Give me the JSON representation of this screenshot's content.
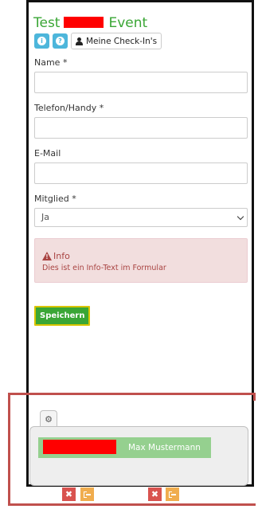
{
  "header": {
    "title_prefix": "Test",
    "title_suffix": "Event",
    "info_icon": "info-circle-icon",
    "help_icon": "question-circle-icon",
    "checkins_label": "Meine Check-In's"
  },
  "form": {
    "name_label": "Name *",
    "name_value": "",
    "phone_label": "Telefon/Handy *",
    "phone_value": "",
    "email_label": "E-Mail",
    "email_value": "",
    "member_label": "Mitglied *",
    "member_selected": "Ja",
    "save_label": "Speichern"
  },
  "alert": {
    "heading": "Info",
    "text": "Dies ist ein Info-Text im Formular"
  },
  "checkin_panel": {
    "settings_icon": "gear-icon",
    "person_name": "Max Mustermann",
    "actions": [
      "delete-icon",
      "logout-icon"
    ]
  },
  "colors": {
    "brand_green": "#3aa635",
    "info_blue": "#4db6db",
    "alert_text": "#a94442",
    "alert_bg": "#f2dede",
    "redaction": "#ff0000",
    "highlight_frame": "#c0504d"
  }
}
